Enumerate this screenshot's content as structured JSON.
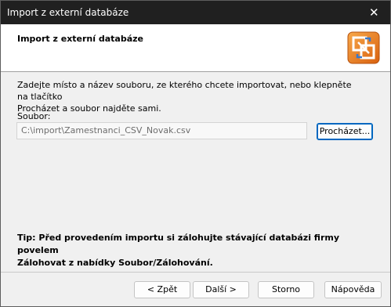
{
  "window": {
    "title": "Import z externí databáze"
  },
  "header": {
    "title": "Import z externí databáze",
    "icon": "import-database-icon"
  },
  "content": {
    "intro_line1": "Zadejte místo a název souboru, ze kterého chcete importovat, nebo klepněte na tlačítko",
    "intro_line2": "Procházet a soubor najděte sami.",
    "file_label": "Soubor:",
    "file_value": "C:\\import\\Zamestnanci_CSV_Novak.csv",
    "browse_label": "Procházet...",
    "tip_line1": "Tip: Před provedením importu si zálohujte stávající databázi firmy povelem",
    "tip_line2": "Zálohovat z nabídky Soubor/Zálohování."
  },
  "buttons": {
    "back": "< Zpět",
    "next": "Další >",
    "cancel": "Storno",
    "help": "Nápověda"
  },
  "colors": {
    "titlebar": "#202020",
    "accent": "#0067c0",
    "icon_orange": "#e87722"
  }
}
